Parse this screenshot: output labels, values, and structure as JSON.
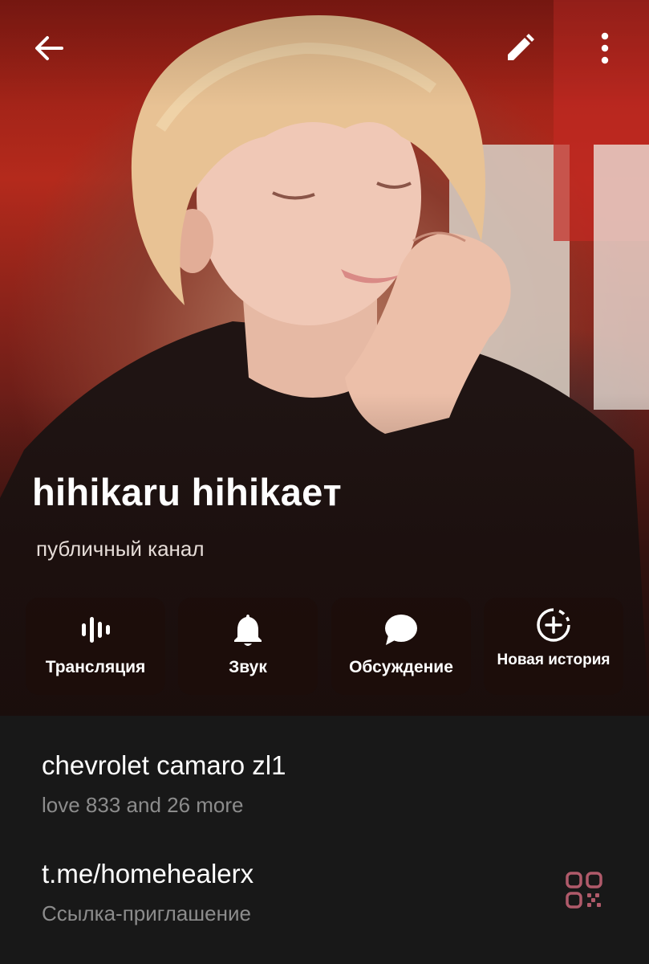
{
  "header": {
    "title": "hihikaru hihikaeт",
    "subtitle": "публичный канал",
    "photo_icon": "person-photo",
    "back_icon": "arrow-left-icon",
    "edit_icon": "pencil-icon",
    "more_icon": "kebab-menu-icon"
  },
  "actions": [
    {
      "label": "Трансляция",
      "icon": "live-stream-icon"
    },
    {
      "label": "Звук",
      "icon": "bell-icon"
    },
    {
      "label": "Обсуждение",
      "icon": "chat-bubble-icon"
    },
    {
      "label": "Новая история",
      "icon": "add-story-icon"
    }
  ],
  "info": {
    "description": {
      "title": "chevrolet camaro zl1",
      "subtitle": "love 833 and 26 more"
    },
    "link": {
      "title": "t.me/homehealerx",
      "subtitle": "Ссылка-приглашение",
      "qr_icon": "qr-code-icon"
    }
  },
  "colors": {
    "background": "#181818",
    "primary_text": "#ffffff",
    "secondary_text": "#8c8c8c",
    "qr_accent": "#b05a6a",
    "action_bg": "rgba(30,12,10,0.55)"
  }
}
